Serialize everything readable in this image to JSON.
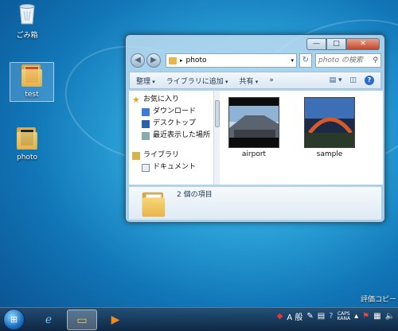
{
  "desktop": {
    "icons": [
      {
        "label": "ごみ箱"
      },
      {
        "label": "test"
      },
      {
        "label": "photo"
      }
    ]
  },
  "window": {
    "controls": {
      "min": "—",
      "max": "□",
      "close": "✕"
    },
    "address": {
      "path": "photo",
      "separator": "▸"
    },
    "search": {
      "placeholder": "photo の検索"
    },
    "toolbar": {
      "organize": "整理",
      "add_to_library": "ライブラリに追加",
      "share": "共有",
      "more": "»",
      "help": "?"
    },
    "nav_pane": {
      "favorites": "お気に入り",
      "items": [
        "ダウンロード",
        "デスクトップ",
        "最近表示した場所"
      ],
      "libraries": "ライブラリ",
      "library_items": [
        "ドキュメント"
      ]
    },
    "files": [
      {
        "name": "airport"
      },
      {
        "name": "sample"
      }
    ],
    "details": {
      "count_text": "2 個の項目"
    }
  },
  "watermark": "評価コピー",
  "tray": {
    "caps": "CAPS",
    "kana": "KANA",
    "ime": "A 般"
  },
  "colors": {
    "accent": "#1b6ec2",
    "folder": "#e7b54a"
  }
}
